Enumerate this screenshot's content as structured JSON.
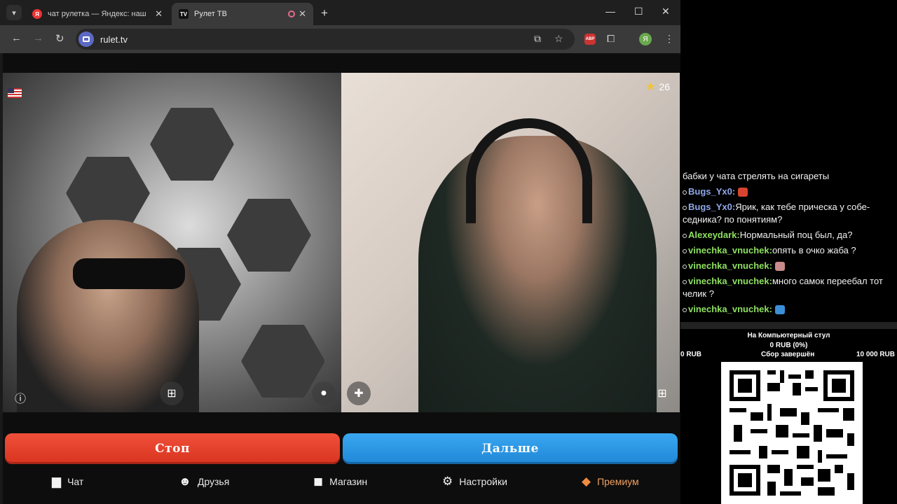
{
  "browser": {
    "tabs": [
      {
        "title": "чат рулетка — Яндекс: нашлось",
        "favicon": "Я"
      },
      {
        "title": "Рулет ТВ",
        "favicon": "TV"
      }
    ],
    "url": "rulet.tv",
    "profile_initial": "Я",
    "extension_badge": "ABP"
  },
  "video": {
    "star_count": "26"
  },
  "buttons": {
    "stop": "Стоп",
    "next": "Дальше"
  },
  "nav": {
    "chat": "Чат",
    "friends": "Друзья",
    "shop": "Магазин",
    "settings": "Настройки",
    "premium": "Премиум"
  },
  "stream_chat": [
    {
      "user": "",
      "text": "бабки у чата стрелять на сигареты"
    },
    {
      "user": "Bugs_Yx0:",
      "text": ""
    },
    {
      "user": "Bugs_Yx0:",
      "text": "Ярик, как тебе прическа у собе-седника? по понятиям?"
    },
    {
      "user": "Alexeydark:",
      "text": "Нормальный поц был, да?"
    },
    {
      "user": "vinechka_vnuchek:",
      "text": "опять в очко жаба ?"
    },
    {
      "user": "vinechka_vnuchek:",
      "text": ""
    },
    {
      "user": "vinechka_vnuchek:",
      "text": "много самок переебал тот челик ?"
    },
    {
      "user": "vinechka_vnuchek:",
      "text": ""
    }
  ],
  "donation_goal": {
    "title": "На Компьютерный стул",
    "amount": "0 RUB (0%)",
    "min": "0 RUB",
    "status": "Сбор завершён",
    "max": "10 000 RUB",
    "progress_percent": 0
  },
  "colors": {
    "stop_button": "#e43f2a",
    "next_button": "#2a95e2",
    "premium": "#f08c40",
    "nick_blue": "#8fa8e8",
    "nick_green": "#8ee060"
  }
}
